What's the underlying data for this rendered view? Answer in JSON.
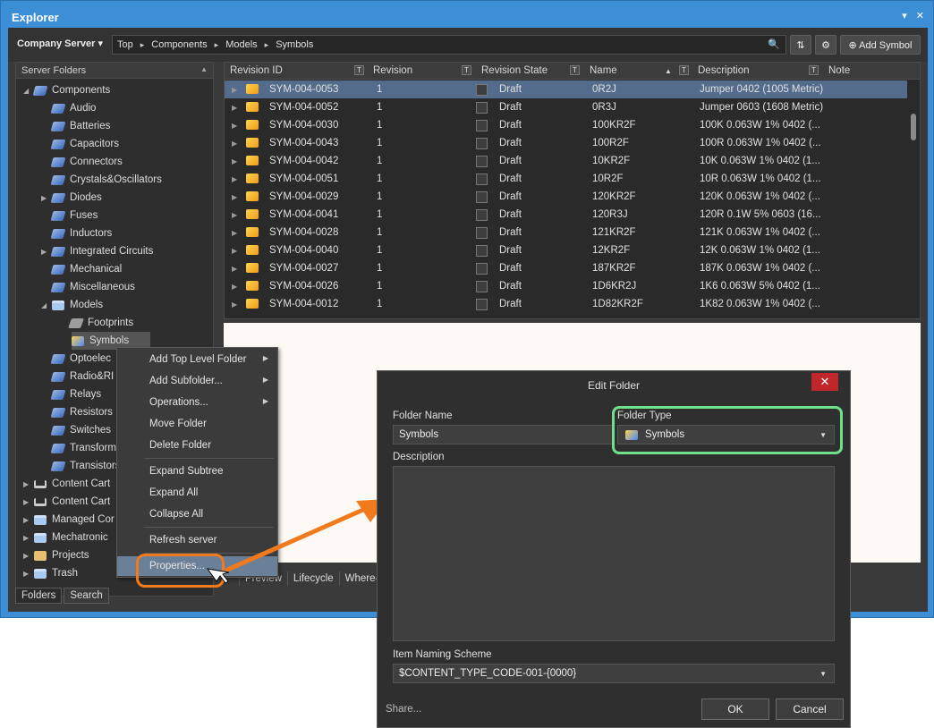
{
  "window": {
    "title": "Explorer",
    "pin_icon": "▾",
    "close_icon": "✕"
  },
  "toolbar": {
    "server": "Company Server ▾",
    "path": [
      "Top",
      "Components",
      "Models",
      "Symbols"
    ],
    "path_sep": "▸",
    "search_icon": "🔍",
    "refresh_icon": "⇅",
    "settings_icon": "⚙",
    "add_label": "⊕ Add Symbol"
  },
  "left_panel": {
    "title": "Server Folders",
    "sort_icon": "▲",
    "tree": [
      {
        "label": "Components",
        "icon": "component",
        "level": 0,
        "expanded": true
      },
      {
        "label": "Audio",
        "icon": "component",
        "level": 1
      },
      {
        "label": "Batteries",
        "icon": "component",
        "level": 1
      },
      {
        "label": "Capacitors",
        "icon": "component",
        "level": 1
      },
      {
        "label": "Connectors",
        "icon": "component",
        "level": 1
      },
      {
        "label": "Crystals&Oscillators",
        "icon": "component",
        "level": 1
      },
      {
        "label": "Diodes",
        "icon": "component",
        "level": 1,
        "collapsed": true
      },
      {
        "label": "Fuses",
        "icon": "component",
        "level": 1
      },
      {
        "label": "Inductors",
        "icon": "component",
        "level": 1
      },
      {
        "label": "Integrated Circuits",
        "icon": "component",
        "level": 1,
        "collapsed": true
      },
      {
        "label": "Mechanical",
        "icon": "component",
        "level": 1
      },
      {
        "label": "Miscellaneous",
        "icon": "component",
        "level": 1
      },
      {
        "label": "Models",
        "icon": "folder",
        "level": 1,
        "expanded": true
      },
      {
        "label": "Footprints",
        "icon": "footprint",
        "level": 2
      },
      {
        "label": "Symbols",
        "icon": "symbol",
        "level": 2,
        "selected": true
      },
      {
        "label": "Optoelec",
        "icon": "component",
        "level": 1
      },
      {
        "label": "Radio&RI",
        "icon": "component",
        "level": 1
      },
      {
        "label": "Relays",
        "icon": "component",
        "level": 1
      },
      {
        "label": "Resistors",
        "icon": "component",
        "level": 1
      },
      {
        "label": "Switches",
        "icon": "component",
        "level": 1
      },
      {
        "label": "Transform",
        "icon": "component",
        "level": 1
      },
      {
        "label": "Transistors",
        "icon": "component",
        "level": 1
      },
      {
        "label": "Content Cart",
        "icon": "cart",
        "level": 0,
        "collapsed": true
      },
      {
        "label": "Content Cart",
        "icon": "cart",
        "level": 0,
        "collapsed": true
      },
      {
        "label": "Managed Cor",
        "icon": "folder",
        "level": 0,
        "collapsed": true
      },
      {
        "label": "Mechatronic",
        "icon": "folder",
        "level": 0,
        "collapsed": true
      },
      {
        "label": "Projects",
        "icon": "project",
        "level": 0,
        "collapsed": true
      },
      {
        "label": "Trash",
        "icon": "folder",
        "level": 0,
        "collapsed": true
      }
    ],
    "tabs": [
      "Folders",
      "Search"
    ]
  },
  "grid": {
    "columns": [
      "Revision ID",
      "Revision",
      "Revision State",
      "Name",
      "Description",
      "Note"
    ],
    "filter_icon": "T",
    "sort_icon": "▲",
    "rows": [
      {
        "id": "SYM-004-0053",
        "rev": "1",
        "state": "Draft",
        "name": "0R2J",
        "desc": "Jumper 0402 (1005 Metric)"
      },
      {
        "id": "SYM-004-0052",
        "rev": "1",
        "state": "Draft",
        "name": "0R3J",
        "desc": "Jumper 0603 (1608 Metric)"
      },
      {
        "id": "SYM-004-0030",
        "rev": "1",
        "state": "Draft",
        "name": "100KR2F",
        "desc": "100K 0.063W 1% 0402 (..."
      },
      {
        "id": "SYM-004-0043",
        "rev": "1",
        "state": "Draft",
        "name": "100R2F",
        "desc": "100R 0.063W 1% 0402 (..."
      },
      {
        "id": "SYM-004-0042",
        "rev": "1",
        "state": "Draft",
        "name": "10KR2F",
        "desc": "10K 0.063W 1% 0402 (1..."
      },
      {
        "id": "SYM-004-0051",
        "rev": "1",
        "state": "Draft",
        "name": "10R2F",
        "desc": "10R 0.063W 1% 0402 (1..."
      },
      {
        "id": "SYM-004-0029",
        "rev": "1",
        "state": "Draft",
        "name": "120KR2F",
        "desc": "120K 0.063W 1% 0402 (..."
      },
      {
        "id": "SYM-004-0041",
        "rev": "1",
        "state": "Draft",
        "name": "120R3J",
        "desc": "120R 0.1W 5% 0603 (16..."
      },
      {
        "id": "SYM-004-0028",
        "rev": "1",
        "state": "Draft",
        "name": "121KR2F",
        "desc": "121K 0.063W 1% 0402 (..."
      },
      {
        "id": "SYM-004-0040",
        "rev": "1",
        "state": "Draft",
        "name": "12KR2F",
        "desc": "12K 0.063W 1% 0402 (1..."
      },
      {
        "id": "SYM-004-0027",
        "rev": "1",
        "state": "Draft",
        "name": "187KR2F",
        "desc": "187K 0.063W 1% 0402 (..."
      },
      {
        "id": "SYM-004-0026",
        "rev": "1",
        "state": "Draft",
        "name": "1D6KR2J",
        "desc": "1K6 0.063W 5% 0402 (1..."
      },
      {
        "id": "SYM-004-0012",
        "rev": "1",
        "state": "Draft",
        "name": "1D82KR2F",
        "desc": "1K82 0.063W 1% 0402 (..."
      }
    ]
  },
  "bottom_tabs": [
    "Preview",
    "Lifecycle",
    "Where-us"
  ],
  "context_menu": {
    "items": [
      {
        "label": "Add Top Level Folder",
        "sub": true
      },
      {
        "label": "Add Subfolder...",
        "sub": true
      },
      {
        "label": "Operations...",
        "sub": true
      },
      {
        "label": "Move Folder"
      },
      {
        "label": "Delete Folder",
        "sep_after": true
      },
      {
        "label": "Expand Subtree"
      },
      {
        "label": "Expand All"
      },
      {
        "label": "Collapse All",
        "sep_after": true
      },
      {
        "label": "Refresh server",
        "sep_after": true
      },
      {
        "label": "Properties...",
        "highlighted": true
      }
    ],
    "sub_icon": "▶"
  },
  "dialog": {
    "title": "Edit Folder",
    "close_icon": "✕",
    "folder_name_label": "Folder Name",
    "folder_name_value": "Symbols",
    "folder_type_label": "Folder Type",
    "folder_type_value": "Symbols",
    "description_label": "Description",
    "description_value": "",
    "naming_label": "Item Naming Scheme",
    "naming_value": "$CONTENT_TYPE_CODE-001-{0000}",
    "dropdown_icon": "▼",
    "share_label": "Share...",
    "ok_label": "OK",
    "cancel_label": "Cancel"
  },
  "colors": {
    "highlight_green": "#6fe08a",
    "callout_orange": "#f07a1c",
    "title_blue": "#3c8fd6"
  }
}
